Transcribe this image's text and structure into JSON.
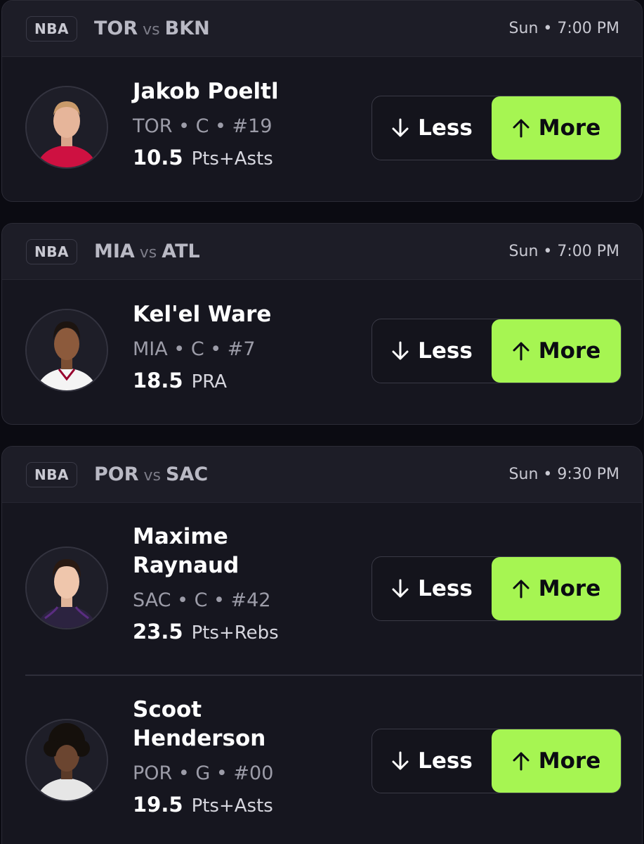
{
  "colors": {
    "background": "#0b0b12",
    "card": "#16161f",
    "card_header": "#1d1d27",
    "more_button": "#a6f552"
  },
  "games": [
    {
      "league": "NBA",
      "team_a": "TOR",
      "vs": "vs",
      "team_b": "BKN",
      "time": "Sun • 7:00 PM",
      "players": [
        {
          "name": "Jakob Poeltl",
          "meta": "TOR • C • #19",
          "line": "10.5",
          "stat": "Pts+Asts",
          "jersey_color": "#ce1141",
          "less_label": "Less",
          "more_label": "More"
        }
      ]
    },
    {
      "league": "NBA",
      "team_a": "MIA",
      "vs": "vs",
      "team_b": "ATL",
      "time": "Sun • 7:00 PM",
      "players": [
        {
          "name": "Kel'el Ware",
          "meta": "MIA • C • #7",
          "line": "18.5",
          "stat": "PRA",
          "jersey_color": "#f4f4f4",
          "less_label": "Less",
          "more_label": "More"
        }
      ]
    },
    {
      "league": "NBA",
      "team_a": "POR",
      "vs": "vs",
      "team_b": "SAC",
      "time": "Sun • 9:30 PM",
      "players": [
        {
          "name": "Maxime\nRaynaud",
          "meta": "SAC • C • #42",
          "line": "23.5",
          "stat": "Pts+Rebs",
          "jersey_color": "#2c2340",
          "less_label": "Less",
          "more_label": "More"
        },
        {
          "name": "Scoot\nHenderson",
          "meta": "POR • G • #00",
          "line": "19.5",
          "stat": "Pts+Asts",
          "jersey_color": "#e6e6e6",
          "less_label": "Less",
          "more_label": "More"
        }
      ]
    }
  ]
}
